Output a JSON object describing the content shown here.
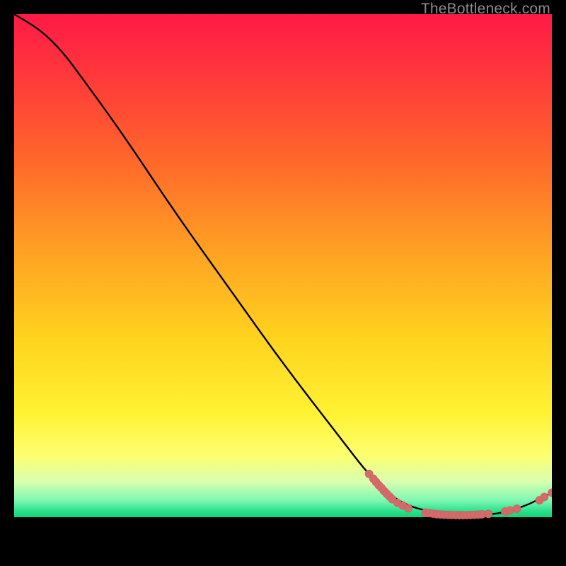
{
  "watermark": "TheBottleneck.com",
  "colors": {
    "curve": "#000000",
    "marker": "#d46a6a",
    "marker_stroke": "#c95f5f"
  },
  "chart_data": {
    "type": "line",
    "title": "",
    "xlabel": "",
    "ylabel": "",
    "xlim": [
      0,
      100
    ],
    "ylim": [
      0,
      100
    ],
    "curve": [
      {
        "x": 0,
        "y": 100
      },
      {
        "x": 5,
        "y": 97
      },
      {
        "x": 9,
        "y": 93
      },
      {
        "x": 12,
        "y": 89
      },
      {
        "x": 20,
        "y": 78
      },
      {
        "x": 30,
        "y": 63
      },
      {
        "x": 40,
        "y": 49
      },
      {
        "x": 50,
        "y": 35
      },
      {
        "x": 60,
        "y": 22
      },
      {
        "x": 67,
        "y": 13
      },
      {
        "x": 72,
        "y": 9
      },
      {
        "x": 78,
        "y": 7.2
      },
      {
        "x": 84,
        "y": 6.8
      },
      {
        "x": 90,
        "y": 7.0
      },
      {
        "x": 95,
        "y": 8.5
      },
      {
        "x": 98,
        "y": 10
      },
      {
        "x": 100,
        "y": 11
      }
    ],
    "markers": [
      {
        "x": 66.0,
        "y": 14.5
      },
      {
        "x": 66.8,
        "y": 13.6
      },
      {
        "x": 67.3,
        "y": 13.0
      },
      {
        "x": 67.8,
        "y": 12.4
      },
      {
        "x": 68.3,
        "y": 11.9
      },
      {
        "x": 68.8,
        "y": 11.3
      },
      {
        "x": 69.3,
        "y": 10.8
      },
      {
        "x": 69.8,
        "y": 10.3
      },
      {
        "x": 70.3,
        "y": 9.8
      },
      {
        "x": 71.3,
        "y": 9.1
      },
      {
        "x": 72.3,
        "y": 8.6
      },
      {
        "x": 73.3,
        "y": 8.1
      },
      {
        "x": 76.5,
        "y": 7.3
      },
      {
        "x": 77.2,
        "y": 7.2
      },
      {
        "x": 77.9,
        "y": 7.1
      },
      {
        "x": 78.6,
        "y": 7.0
      },
      {
        "x": 79.3,
        "y": 6.95
      },
      {
        "x": 80.0,
        "y": 6.9
      },
      {
        "x": 80.7,
        "y": 6.87
      },
      {
        "x": 81.4,
        "y": 6.85
      },
      {
        "x": 82.1,
        "y": 6.83
      },
      {
        "x": 82.8,
        "y": 6.82
      },
      {
        "x": 83.5,
        "y": 6.82
      },
      {
        "x": 84.2,
        "y": 6.83
      },
      {
        "x": 84.9,
        "y": 6.85
      },
      {
        "x": 85.6,
        "y": 6.88
      },
      {
        "x": 86.3,
        "y": 6.92
      },
      {
        "x": 87.0,
        "y": 6.97
      },
      {
        "x": 88.2,
        "y": 7.05
      },
      {
        "x": 91.3,
        "y": 7.5
      },
      {
        "x": 92.2,
        "y": 7.7
      },
      {
        "x": 93.5,
        "y": 8.0
      },
      {
        "x": 97.7,
        "y": 9.6
      },
      {
        "x": 98.6,
        "y": 10.2
      },
      {
        "x": 100.0,
        "y": 11.0
      }
    ],
    "marker_radius": 5.6
  }
}
